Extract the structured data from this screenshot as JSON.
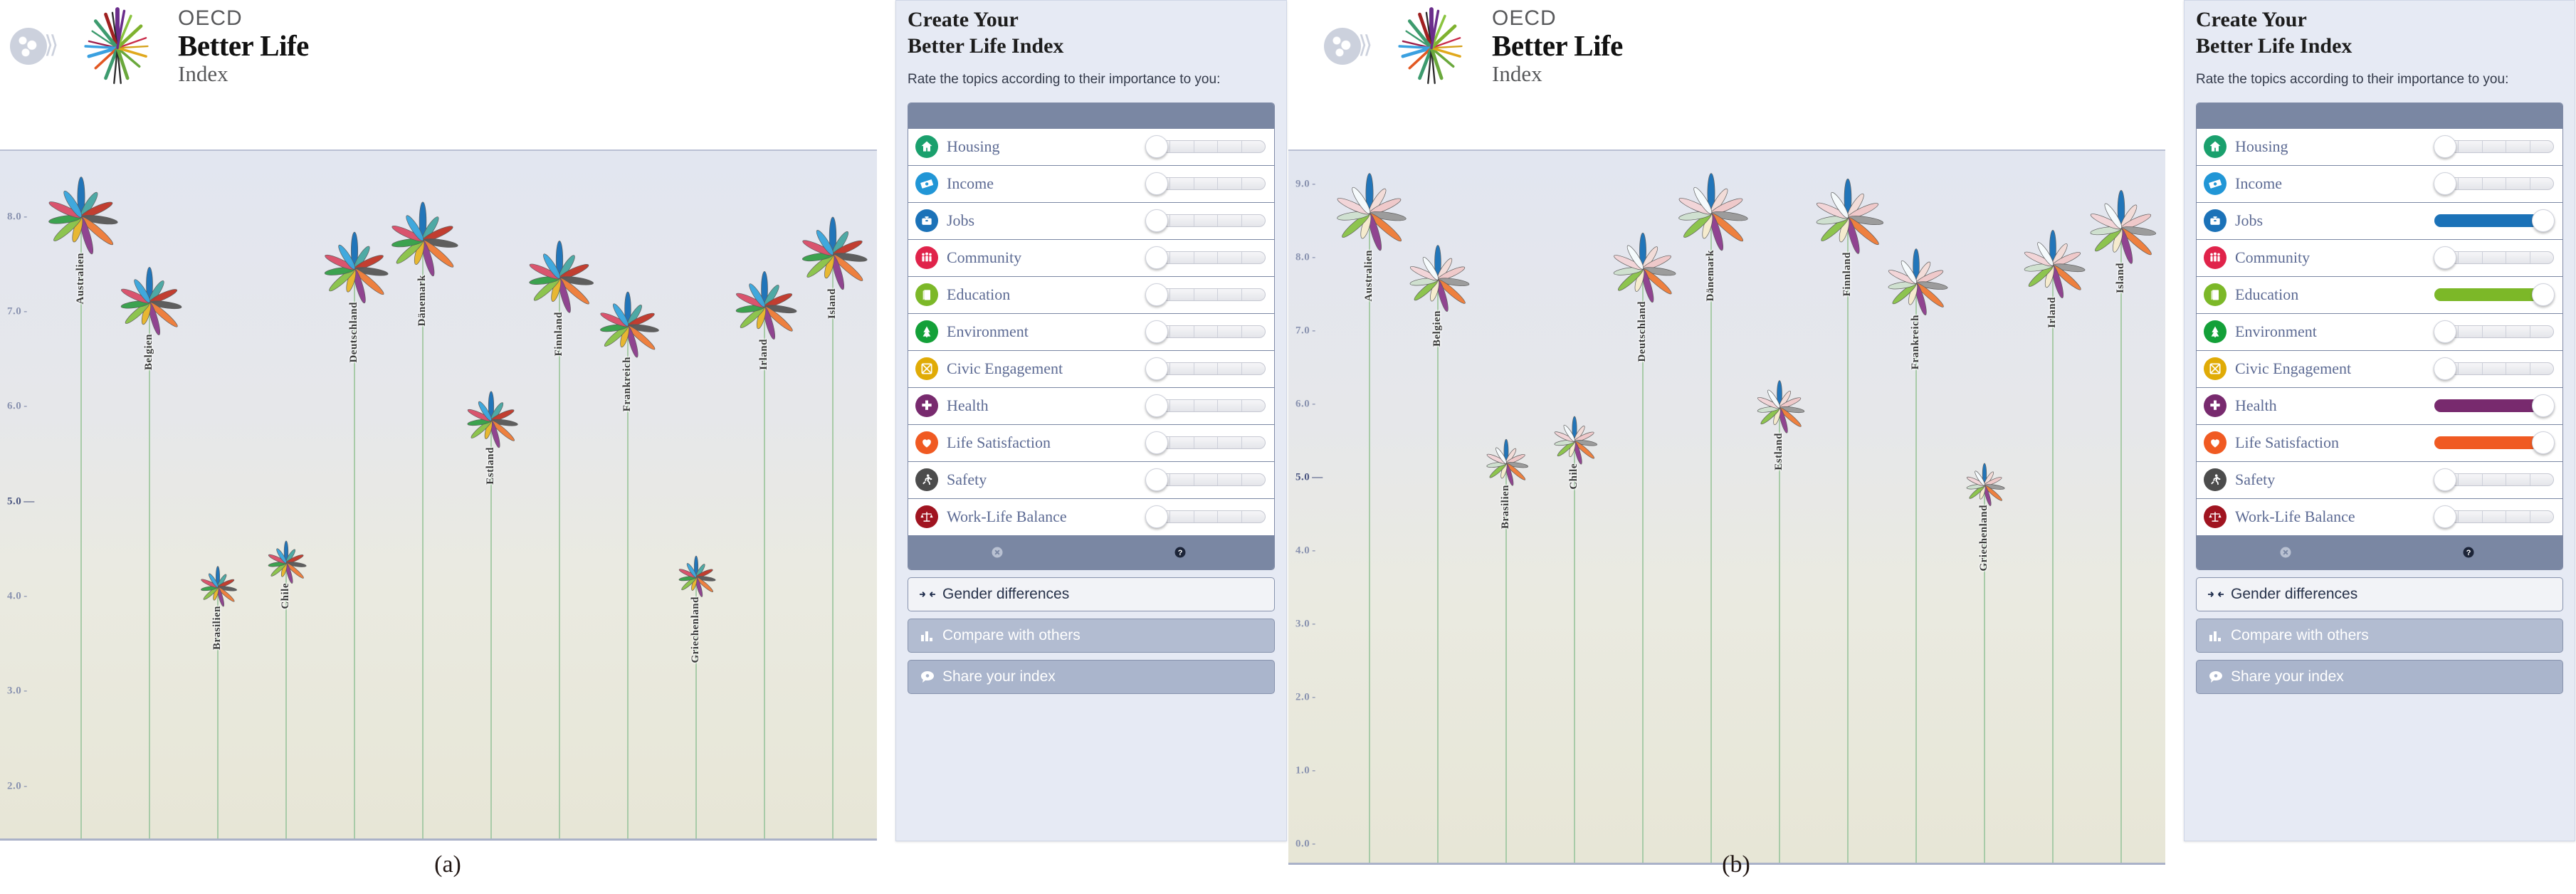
{
  "figure": {
    "panels": [
      {
        "key": "a",
        "caption": "(a)"
      },
      {
        "key": "b",
        "caption": "(b)"
      }
    ]
  },
  "brand": {
    "line1": "OECD",
    "line2": "Better Life",
    "line3": "Index",
    "globe_icon": "globe-icon",
    "burst_icon": "oecd-burst-icon"
  },
  "sidebar": {
    "title_line1": "Create Your",
    "title_line2": "Better Life Index",
    "instruction": "Rate the topics according to their importance to you:",
    "minus_label": "–",
    "plus_label": "+",
    "reset_label": "Reset",
    "help_label": "Help",
    "gender_label": "Gender differences",
    "compare_label": "Compare with others",
    "share_label": "Share your index",
    "topics": [
      {
        "label": "Housing",
        "icon": "house-icon",
        "color": "#1aa06d"
      },
      {
        "label": "Income",
        "icon": "banknote-icon",
        "color": "#2196d6"
      },
      {
        "label": "Jobs",
        "icon": "toolbox-icon",
        "color": "#1b72b8"
      },
      {
        "label": "Community",
        "icon": "people-icon",
        "color": "#e0234a"
      },
      {
        "label": "Education",
        "icon": "book-icon",
        "color": "#7cb828"
      },
      {
        "label": "Environment",
        "icon": "tree-icon",
        "color": "#13a038"
      },
      {
        "label": "Civic Engagement",
        "icon": "ballot-box-icon",
        "color": "#e0ab06"
      },
      {
        "label": "Health",
        "icon": "medical-cross-icon",
        "color": "#782a6e"
      },
      {
        "label": "Life Satisfaction",
        "icon": "heart-icon",
        "color": "#f05a22"
      },
      {
        "label": "Safety",
        "icon": "running-person-icon",
        "color": "#4c4c4c"
      },
      {
        "label": "Work-Life Balance",
        "icon": "scales-icon",
        "color": "#a01420"
      }
    ],
    "slider_max": 5,
    "weights_a": [
      1,
      1,
      1,
      1,
      1,
      1,
      1,
      1,
      1,
      1,
      1
    ],
    "weights_b": [
      1,
      1,
      5,
      1,
      5,
      1,
      1,
      5,
      5,
      1,
      1
    ]
  },
  "chart_data": [
    {
      "panel": "a",
      "type": "bar",
      "title": "",
      "xlabel": "",
      "ylabel": "",
      "grid": true,
      "legend": "none",
      "ytick_labels": [
        "8.0",
        "7.0",
        "6.0",
        "5.0",
        "4.0",
        "3.0",
        "2.0"
      ],
      "ytick_values": [
        8.0,
        7.0,
        6.0,
        5.0,
        4.0,
        3.0,
        2.0
      ],
      "ytick_emphasis": "5.0",
      "ylim": [
        1.45,
        8.65
      ],
      "categories": [
        "Australien",
        "Belgien",
        "Brasilien",
        "Chile",
        "Deutschland",
        "Dänemark",
        "Estland",
        "Finnland",
        "Frankreich",
        "Griechenland",
        "Irland",
        "Island"
      ],
      "values": [
        8.0,
        7.1,
        4.1,
        4.35,
        7.45,
        7.75,
        5.85,
        7.35,
        6.85,
        4.2,
        7.05,
        7.6
      ],
      "petal_scale": [
        1.0,
        0.88,
        0.52,
        0.55,
        0.92,
        0.96,
        0.73,
        0.93,
        0.85,
        0.53,
        0.88,
        0.94
      ]
    },
    {
      "panel": "b",
      "type": "bar",
      "title": "",
      "xlabel": "",
      "ylabel": "",
      "grid": true,
      "legend": "none",
      "ytick_labels": [
        "9.0",
        "8.0",
        "7.0",
        "6.0",
        "5.0",
        "4.0",
        "3.0",
        "2.0",
        "1.0",
        "0.0"
      ],
      "ytick_values": [
        9.0,
        8.0,
        7.0,
        6.0,
        5.0,
        4.0,
        3.0,
        2.0,
        1.0,
        0.0
      ],
      "ytick_emphasis": "5.0",
      "ylim": [
        -0.25,
        9.4
      ],
      "categories": [
        "Australien",
        "Belgien",
        "Brasilien",
        "Chile",
        "Deutschland",
        "Dänemark",
        "Estland",
        "Finnland",
        "Frankreich",
        "Griechenland",
        "Irland",
        "Island"
      ],
      "values": [
        8.6,
        7.7,
        5.2,
        5.5,
        7.85,
        8.6,
        5.95,
        8.55,
        7.65,
        4.9,
        7.9,
        8.4
      ],
      "petal_scale": [
        1.0,
        0.86,
        0.6,
        0.62,
        0.9,
        1.0,
        0.68,
        0.97,
        0.86,
        0.55,
        0.88,
        0.95
      ]
    }
  ],
  "petal_colors": [
    "#1b72b8",
    "#4aa8a3",
    "#c0392b",
    "#5a5a5a",
    "#ef7d3a",
    "#8e3f8e",
    "#e8b62c",
    "#8bc34a",
    "#37a04a",
    "#d9506a",
    "#3ba7dd"
  ],
  "petal_colors_b": [
    "#1b72b8",
    "#f3dcd8",
    "#f0c9c9",
    "#9a9a9a",
    "#ef7d3a",
    "#8e3f8e",
    "#f6eccd",
    "#8bc34a",
    "#cfe0cf",
    "#f3d5d8",
    "#f6fbfd"
  ]
}
